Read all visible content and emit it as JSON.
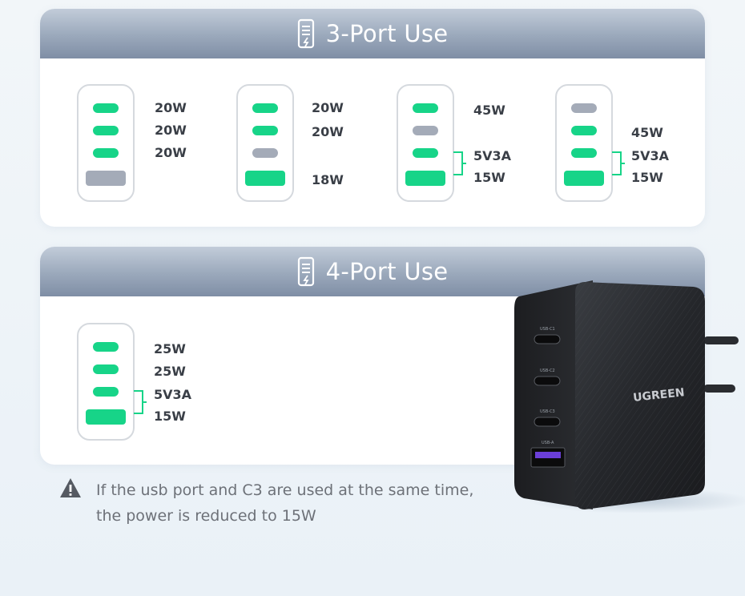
{
  "three_port": {
    "title": "3-Port Use",
    "configs": [
      {
        "ports": [
          "on",
          "on",
          "on",
          "off-a"
        ],
        "labels": [
          "20W",
          "20W",
          "20W"
        ]
      },
      {
        "ports": [
          "on",
          "on",
          "off",
          "on-a"
        ],
        "labels": [
          "20W",
          "20W",
          "18W"
        ]
      },
      {
        "ports": [
          "on",
          "off",
          "on",
          "on-a"
        ],
        "labels": [
          "45W",
          "5V3A",
          "15W"
        ]
      },
      {
        "ports": [
          "off",
          "on",
          "on",
          "on-a"
        ],
        "labels": [
          "45W",
          "5V3A",
          "15W"
        ]
      }
    ]
  },
  "four_port": {
    "title": "4-Port Use",
    "configs": [
      {
        "ports": [
          "on",
          "on",
          "on",
          "on-a"
        ],
        "labels": [
          "25W",
          "25W",
          "5V3A",
          "15W"
        ]
      }
    ]
  },
  "warning": {
    "line1": "If the usb port and C3 are used at the same time,",
    "line2": "the power is reduced to 15W"
  },
  "charger": {
    "brand": "UGREEN",
    "port_labels": [
      "USB-C1",
      "USB-C2",
      "USB-C3",
      "USB-A"
    ]
  },
  "colors": {
    "active_port": "#17d488",
    "inactive_port": "#a4abb8",
    "header": "#9aa8bb"
  }
}
